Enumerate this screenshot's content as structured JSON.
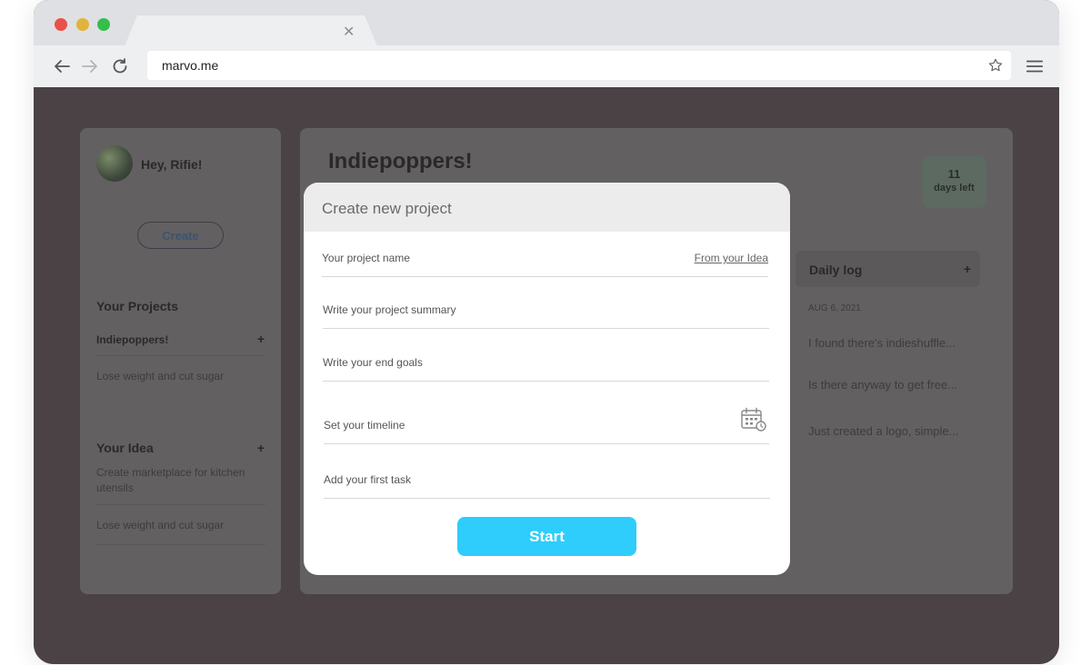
{
  "browser": {
    "url": "marvo.me"
  },
  "sidebar": {
    "greeting": "Hey, Rifie!",
    "create_label": "Create",
    "projects_title": "Your Projects",
    "projects": [
      {
        "label": "Indiepoppers!"
      },
      {
        "label": "Lose weight and cut sugar"
      }
    ],
    "idea_title": "Your Idea",
    "ideas": [
      {
        "label": "Create marketplace for kitchen utensils"
      },
      {
        "label": "Lose weight and cut sugar"
      }
    ]
  },
  "main": {
    "title": "Indiepoppers!",
    "days_count": "11",
    "days_label": "days left"
  },
  "daily_log": {
    "title": "Daily log",
    "date": "AUG 6, 2021",
    "entries": [
      {
        "text": "I found there's indieshuffle..."
      },
      {
        "text": "Is there anyway to get free..."
      },
      {
        "text": "Just created a logo, simple..."
      }
    ]
  },
  "modal": {
    "title": "Create new project",
    "fields": {
      "name": {
        "placeholder": "Your project name",
        "link": "From your Idea"
      },
      "summary": {
        "placeholder": "Write your project summary"
      },
      "goals": {
        "placeholder": "Write your end goals"
      },
      "timeline": {
        "placeholder": "Set your timeline"
      },
      "task": {
        "placeholder": "Add your first task"
      }
    },
    "start_label": "Start"
  },
  "colors": {
    "accent": "#2ecdfb",
    "overlay": "#4a4245"
  },
  "icons": [
    "close-icon",
    "back-arrow-icon",
    "forward-arrow-icon",
    "reload-icon",
    "star-icon",
    "hamburger-menu-icon",
    "plus-icon",
    "calendar-clock-icon"
  ]
}
